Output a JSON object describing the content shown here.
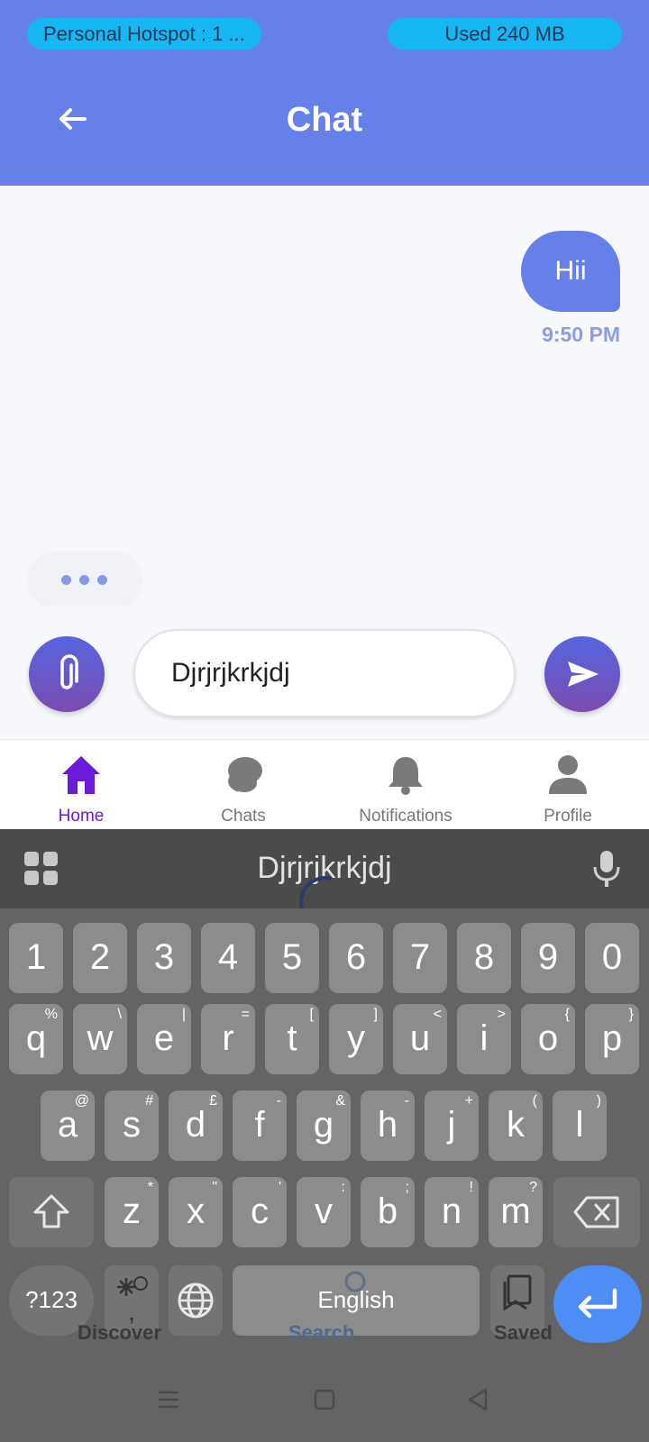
{
  "status": {
    "hotspot": "Personal Hotspot : 1 ...",
    "data_used": "Used  240 MB"
  },
  "header": {
    "back_icon": "arrow-left-icon",
    "title": "Chat"
  },
  "messages": [
    {
      "text": "Hii",
      "time": "9:50 PM",
      "sender": "me"
    }
  ],
  "composer": {
    "attach_icon": "paperclip-icon",
    "input_value": "Djrjrjkrkjdj",
    "send_icon": "send-icon"
  },
  "nav": {
    "items": [
      {
        "label": "Home",
        "icon": "home-icon",
        "active": true
      },
      {
        "label": "Chats",
        "icon": "chat-bubbles-icon",
        "active": false
      },
      {
        "label": "Notifications",
        "icon": "bell-icon",
        "active": false
      },
      {
        "label": "Profile",
        "icon": "user-icon",
        "active": false
      }
    ]
  },
  "keyboard": {
    "suggestion": "Djrjrjkrkjdj",
    "numbers": [
      "1",
      "2",
      "3",
      "4",
      "5",
      "6",
      "7",
      "8",
      "9",
      "0"
    ],
    "row1": [
      [
        "q",
        "%"
      ],
      [
        "w",
        "\\"
      ],
      [
        "e",
        "|"
      ],
      [
        "r",
        "="
      ],
      [
        "t",
        "["
      ],
      [
        "y",
        "]"
      ],
      [
        "u",
        "<"
      ],
      [
        "i",
        ">"
      ],
      [
        "o",
        "{"
      ],
      [
        "p",
        "}"
      ]
    ],
    "row2": [
      [
        "a",
        "@"
      ],
      [
        "s",
        "#"
      ],
      [
        "d",
        "£"
      ],
      [
        "f",
        "-"
      ],
      [
        "g",
        "&"
      ],
      [
        "h",
        "-"
      ],
      [
        "j",
        "+"
      ],
      [
        "k",
        "("
      ],
      [
        "l",
        ")"
      ]
    ],
    "row3": [
      [
        "z",
        "*"
      ],
      [
        "x",
        "\""
      ],
      [
        "c",
        "'"
      ],
      [
        "v",
        ":"
      ],
      [
        "b",
        ";"
      ],
      [
        "n",
        "!"
      ],
      [
        "m",
        "?"
      ]
    ],
    "symbols_key": "?123",
    "comma": ",",
    "space_label": "English",
    "period": ".",
    "overlay": {
      "discover": "Discover",
      "search": "Search",
      "saved": "Saved"
    },
    "colors": {
      "accent": "#4d8df4",
      "header": "#6680ea",
      "active_nav": "#6a1bd6"
    }
  }
}
